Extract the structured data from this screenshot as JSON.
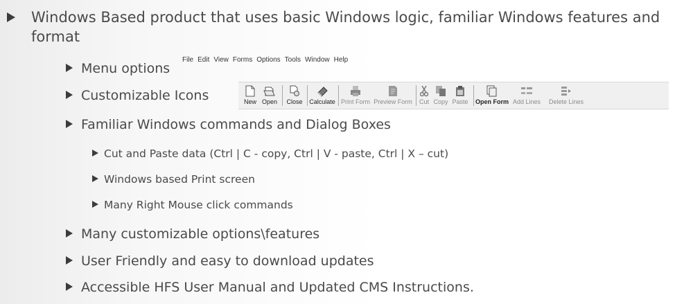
{
  "main_bullet": "Windows Based product that uses basic Windows logic, familiar Windows features and format",
  "menu_options": "Menu options",
  "menubar": [
    "File",
    "Edit",
    "View",
    "Forms",
    "Options",
    "Tools",
    "Window",
    "Help"
  ],
  "customizable_icons": "Customizable Icons",
  "toolbar": {
    "new": "New",
    "open": "Open",
    "close": "Close",
    "calculate": "Calculate",
    "print_form": "Print Form",
    "preview_form": "Preview Form",
    "cut": "Cut",
    "copy": "Copy",
    "paste": "Paste",
    "open_form": "Open Form",
    "add_lines": "Add Lines",
    "delete_lines": "Delete Lines"
  },
  "familiar": "Familiar Windows commands and Dialog Boxes",
  "sub": [
    "Cut and Paste data (Ctrl | C - copy, Ctrl | V - paste, Ctrl | X – cut)",
    "Windows based Print screen",
    "Many Right Mouse click commands"
  ],
  "customizable_options": "Many customizable options\\features",
  "user_friendly": "User Friendly and easy to download updates",
  "accessible": "Accessible HFS User Manual and Updated CMS Instructions."
}
